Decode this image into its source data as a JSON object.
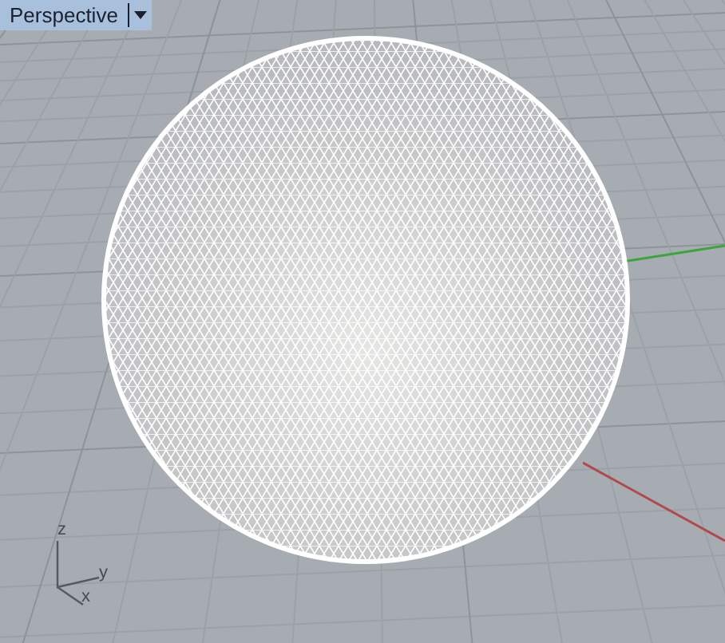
{
  "viewport": {
    "title": "Perspective",
    "axes": [
      {
        "label": "z"
      },
      {
        "label": "y"
      },
      {
        "label": "x"
      }
    ]
  }
}
